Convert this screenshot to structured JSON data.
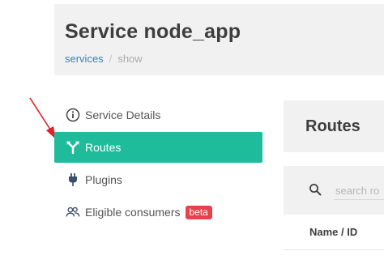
{
  "header": {
    "title": "Service node_app",
    "breadcrumb": {
      "link": "services",
      "separator": "/",
      "current": "show"
    }
  },
  "sidebar": {
    "items": [
      {
        "label": "Service Details",
        "icon": "info-icon",
        "active": false
      },
      {
        "label": "Routes",
        "icon": "route-fork-icon",
        "active": true
      },
      {
        "label": "Plugins",
        "icon": "plug-icon",
        "active": false
      },
      {
        "label": "Eligible consumers",
        "icon": "users-icon",
        "active": false,
        "badge": "beta"
      }
    ]
  },
  "main": {
    "title": "Routes",
    "search": {
      "placeholder": "search ro"
    },
    "table": {
      "columns": [
        "Name / ID"
      ]
    }
  },
  "colors": {
    "accent": "#1fbc9c",
    "badge": "#e8414d",
    "link": "#3f7fb6",
    "annotation_arrow": "#e0202a"
  }
}
